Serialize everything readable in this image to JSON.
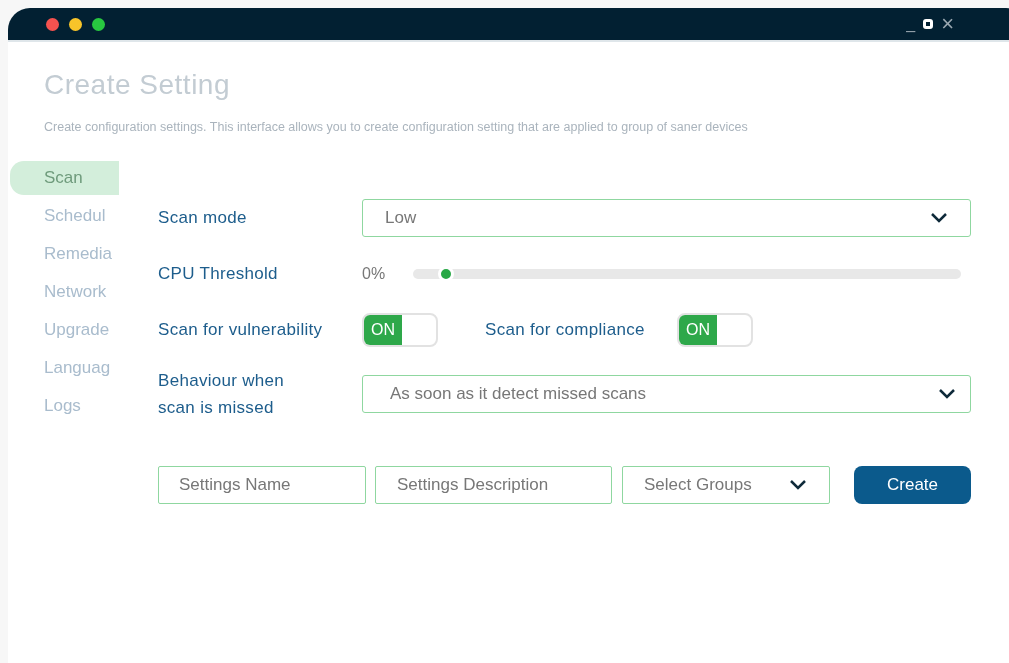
{
  "window": {
    "title_controls": [
      "_",
      "×"
    ]
  },
  "header": {
    "title": "Create Setting",
    "subtitle": "Create configuration settings. This interface allows you to create configuration setting that are applied to group of saner devices"
  },
  "sidebar": {
    "items": [
      {
        "label": "Scan",
        "selected": true
      },
      {
        "label": "Schedul",
        "selected": false
      },
      {
        "label": "Remedia",
        "selected": false
      },
      {
        "label": "Network",
        "selected": false
      },
      {
        "label": "Upgrade",
        "selected": false
      },
      {
        "label": "Languag",
        "selected": false
      },
      {
        "label": "Logs",
        "selected": false
      }
    ]
  },
  "form": {
    "scan_mode": {
      "label": "Scan mode",
      "value": "Low"
    },
    "cpu_threshold": {
      "label": "CPU Threshold",
      "reading": "0%",
      "level": 0.06
    },
    "scan_vulnerability": {
      "label": "Scan for vulnerability",
      "on": true,
      "state_label": "ON"
    },
    "scan_compliance": {
      "label": "Scan for compliance",
      "on": true,
      "state_label": "ON"
    },
    "missed_behaviour": {
      "label_lines": [
        "Behaviour when",
        "scan is missed"
      ],
      "value": "As soon as it detect missed scans"
    },
    "settings_name": {
      "placeholder": "Settings Name"
    },
    "settings_description": {
      "placeholder": "Settings Description"
    },
    "groups": {
      "placeholder": "Select Groups"
    },
    "create_button": "Create"
  }
}
